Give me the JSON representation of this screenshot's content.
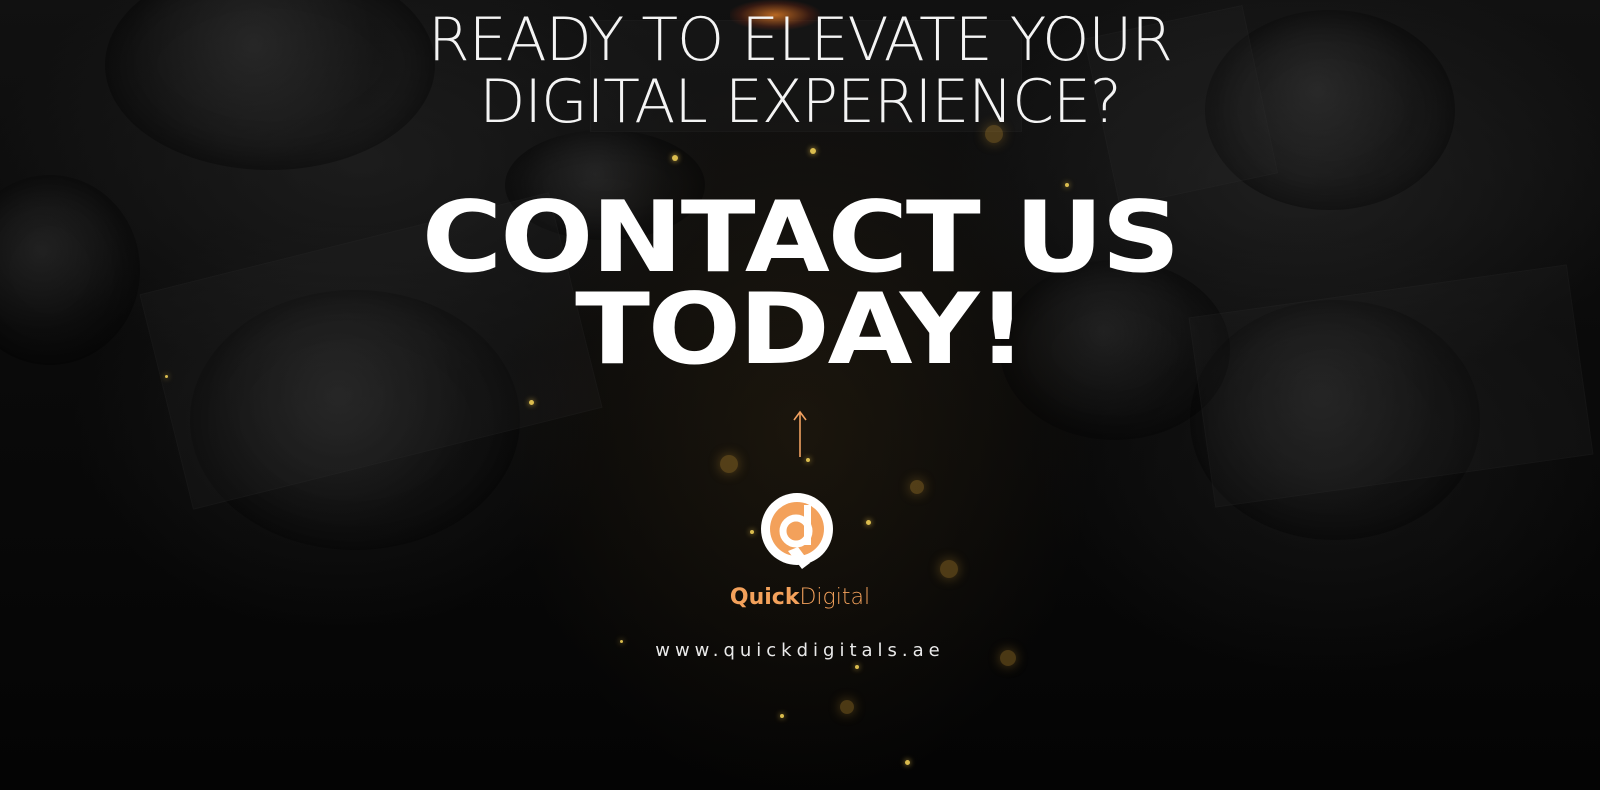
{
  "headline": {
    "line1": "READY TO ELEVATE YOUR",
    "line2": "DIGITAL EXPERIENCE?"
  },
  "cta": {
    "line1": "CONTACT US",
    "line2": "TODAY!"
  },
  "arrow": {
    "icon": "arrow-up-icon",
    "color": "#f0a060"
  },
  "logo": {
    "icon": "quickdigital-logo",
    "brand_bold": "Quick",
    "brand_light": "Digital",
    "accent_color": "#f3a15b",
    "mark_color": "#ffffff"
  },
  "website": "www.quickdigitals.ae",
  "colors": {
    "background": "#050505",
    "text": "#ffffff"
  }
}
